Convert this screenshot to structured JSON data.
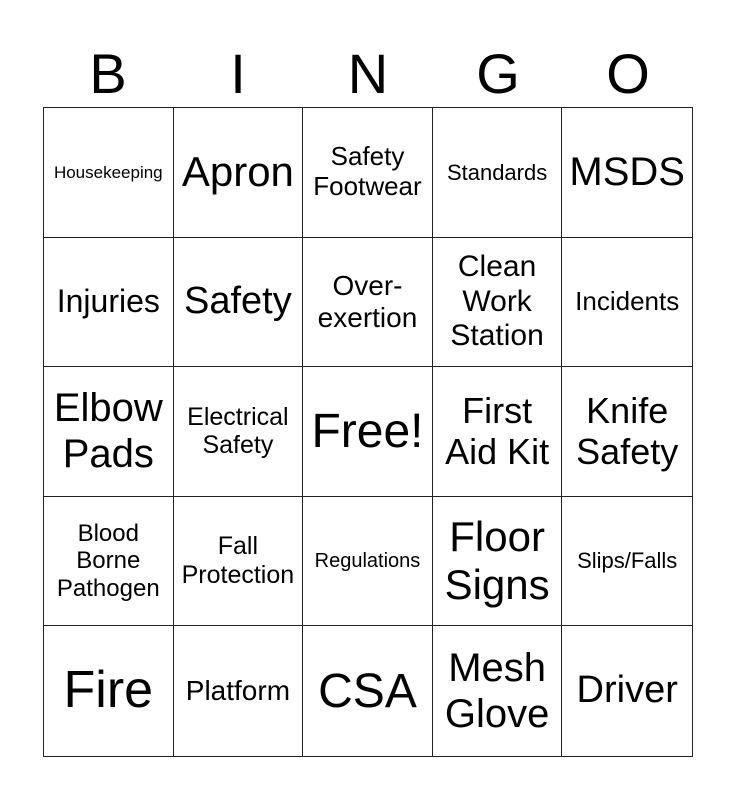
{
  "header": [
    "B",
    "I",
    "N",
    "G",
    "O"
  ],
  "cells": [
    {
      "text": "Housekeeping",
      "size": 17
    },
    {
      "text": "Apron",
      "size": 42
    },
    {
      "text": "Safety Footwear",
      "size": 26
    },
    {
      "text": "Standards",
      "size": 22
    },
    {
      "text": "MSDS",
      "size": 40
    },
    {
      "text": "Injuries",
      "size": 32
    },
    {
      "text": "Safety",
      "size": 38
    },
    {
      "text": "Over-exertion",
      "size": 28
    },
    {
      "text": "Clean Work Station",
      "size": 30
    },
    {
      "text": "Incidents",
      "size": 26
    },
    {
      "text": "Elbow Pads",
      "size": 40
    },
    {
      "text": "Electrical Safety",
      "size": 25
    },
    {
      "text": "Free!",
      "size": 48
    },
    {
      "text": "First Aid Kit",
      "size": 36
    },
    {
      "text": "Knife Safety",
      "size": 36
    },
    {
      "text": "Blood Borne Pathogen",
      "size": 24
    },
    {
      "text": "Fall Protection",
      "size": 25
    },
    {
      "text": "Regulations",
      "size": 20
    },
    {
      "text": "Floor Signs",
      "size": 42
    },
    {
      "text": "Slips/Falls",
      "size": 22
    },
    {
      "text": "Fire",
      "size": 52
    },
    {
      "text": "Platform",
      "size": 28
    },
    {
      "text": "CSA",
      "size": 48
    },
    {
      "text": "Mesh Glove",
      "size": 40
    },
    {
      "text": "Driver",
      "size": 38
    }
  ]
}
